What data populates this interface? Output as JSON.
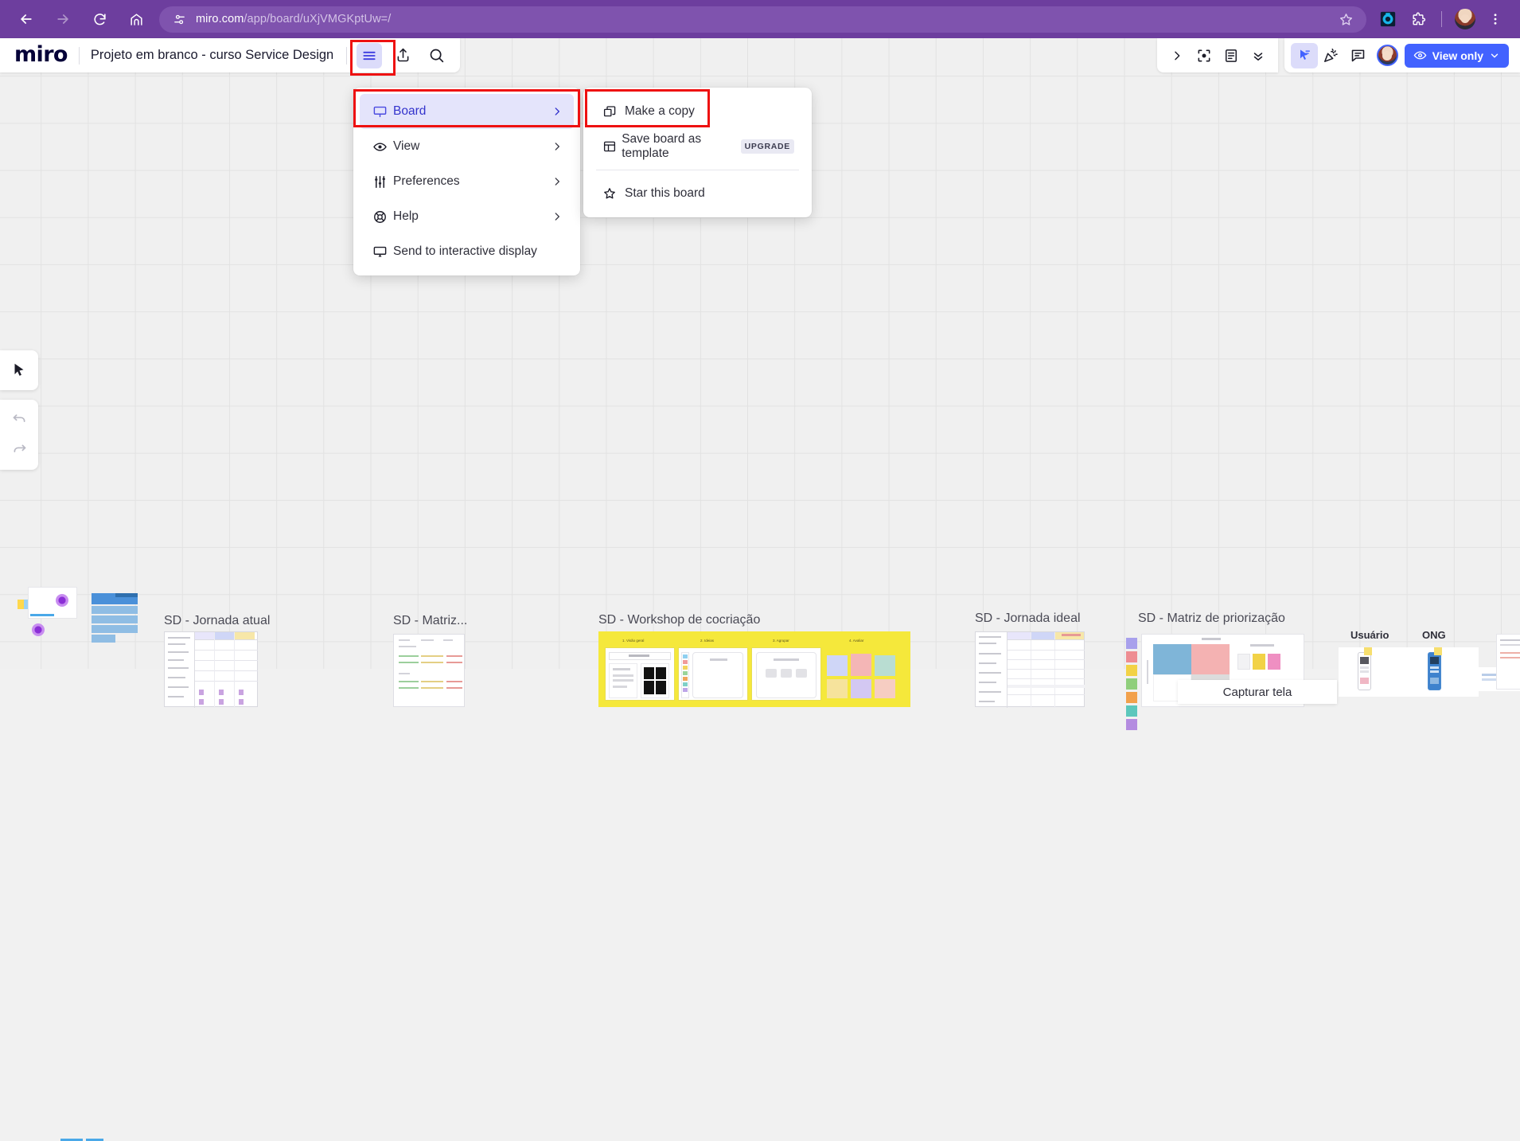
{
  "browser": {
    "back_icon": "arrow-left-icon",
    "forward_icon": "arrow-right-icon",
    "reload_icon": "reload-icon",
    "home_icon": "home-icon",
    "site_info_icon": "site-settings-icon",
    "url_domain": "miro.com",
    "url_path": "/app/board/uXjVMGKptUw=/",
    "star_icon": "bookmark-star-icon",
    "extension_icon": "extension-app-icon",
    "extensions_icon": "puzzle-extensions-icon",
    "profile_icon": "browser-profile-avatar",
    "menu_icon": "three-dot-menu-icon",
    "accent_color": "#6d3e9e"
  },
  "miro": {
    "logo": "miro",
    "board_title": "Projeto em branco - curso Service Design",
    "hamburger_icon": "hamburger-menu-icon",
    "share_icon": "share-upload-icon",
    "search_icon": "search-icon",
    "right_tools": [
      {
        "icon": "chevron-right-icon",
        "name": "expand-panel"
      },
      {
        "icon": "frame-focus-icon",
        "name": "fit-to-screen"
      },
      {
        "icon": "notes-document-icon",
        "name": "notes"
      },
      {
        "icon": "double-chevron-down-icon",
        "name": "collapse"
      }
    ],
    "right_tools2": [
      {
        "icon": "cursor-pointer-icon",
        "name": "pointer-tool",
        "active": true
      },
      {
        "icon": "party-popper-icon",
        "name": "reactions-tool",
        "active": false
      },
      {
        "icon": "comment-icon",
        "name": "comments-tool",
        "active": false
      }
    ],
    "view_only_label": "View only",
    "view_only_eye_icon": "eye-icon",
    "view_only_chevron": "chevron-down-icon",
    "view_only_color": "#4262ff",
    "left_rail": [
      {
        "icon": "cursor-select-icon",
        "name": "select-tool"
      },
      {
        "icon": "undo-icon",
        "name": "undo-button"
      },
      {
        "icon": "redo-icon",
        "name": "redo-button"
      }
    ]
  },
  "board_menu": {
    "highlight_color": "#ee1111",
    "items": [
      {
        "label": "Board",
        "icon": "board-icon",
        "chevron": "›",
        "selected": true
      },
      {
        "label": "View",
        "icon": "eye-icon",
        "chevron": "›",
        "selected": false
      },
      {
        "label": "Preferences",
        "icon": "sliders-icon",
        "chevron": "›",
        "selected": false
      },
      {
        "label": "Help",
        "icon": "help-lifebuoy-icon",
        "chevron": "›",
        "selected": false
      },
      {
        "label": "Send to interactive display",
        "icon": "display-icon",
        "chevron": "",
        "selected": false
      }
    ]
  },
  "submenu": {
    "items": [
      {
        "label": "Make a copy",
        "icon": "copy-icon",
        "badge": "",
        "highlighted": true
      },
      {
        "label": "Save board as template",
        "icon": "template-icon",
        "badge": "UPGRADE",
        "highlighted": false
      },
      {
        "label": "Star this board",
        "icon": "star-icon",
        "badge": "",
        "highlighted": false
      }
    ]
  },
  "canvas": {
    "background_color": "#f0f0f0",
    "grid_color": "#e2e2e2",
    "frames": [
      {
        "label": "SD - Jornada atual"
      },
      {
        "label": "SD - Matriz..."
      },
      {
        "label": "SD - Workshop de cocriação"
      },
      {
        "label": "SD - Jornada ideal"
      },
      {
        "label": "SD - Matriz de priorização"
      },
      {
        "label": "Usuário"
      },
      {
        "label": "ONG"
      }
    ],
    "workshop_steps": [
      "1. Visão geral",
      "2. Ideias",
      "3. Agrupar",
      "4. Avaliar"
    ],
    "workshop_color": "#f5e83b",
    "tooltip": "Capturar tela"
  }
}
